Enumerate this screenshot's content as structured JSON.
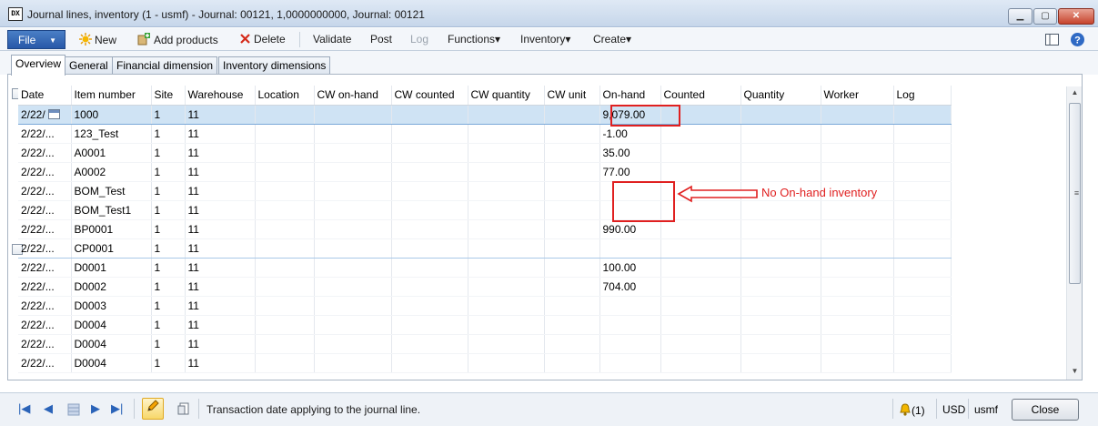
{
  "window": {
    "title": "Journal lines, inventory (1 - usmf) - Journal: 00121, 1,0000000000, Journal: 00121",
    "app_icon_text": "DX",
    "min_glyph": "▁",
    "max_glyph": "▢",
    "close_glyph": "✕"
  },
  "ribbon": {
    "file_label": "File",
    "new_label": "New",
    "add_products_label": "Add products",
    "delete_label": "Delete",
    "validate_label": "Validate",
    "post_label": "Post",
    "log_label": "Log",
    "functions_label": "Functions",
    "inventory_label": "Inventory",
    "create_label": "Create",
    "dropdown_glyph": "▾"
  },
  "tabs": [
    "Overview",
    "General",
    "Financial dimension",
    "Inventory dimensions"
  ],
  "grid": {
    "columns": [
      "Date",
      "Item number",
      "Site",
      "Warehouse",
      "Location",
      "CW on-hand",
      "CW counted",
      "CW quantity",
      "CW unit",
      "On-hand",
      "Counted",
      "Quantity",
      "Worker",
      "Log"
    ],
    "rows": [
      {
        "date": "2/22/",
        "item": "1000",
        "site": "1",
        "warehouse": "11",
        "onhand": "9,079.00"
      },
      {
        "date": "2/22/...",
        "item": "123_Test",
        "site": "1",
        "warehouse": "11",
        "onhand": "-1.00"
      },
      {
        "date": "2/22/...",
        "item": "A0001",
        "site": "1",
        "warehouse": "11",
        "onhand": "35.00"
      },
      {
        "date": "2/22/...",
        "item": "A0002",
        "site": "1",
        "warehouse": "11",
        "onhand": "77.00"
      },
      {
        "date": "2/22/...",
        "item": "BOM_Test",
        "site": "1",
        "warehouse": "11",
        "onhand": ""
      },
      {
        "date": "2/22/...",
        "item": "BOM_Test1",
        "site": "1",
        "warehouse": "11",
        "onhand": ""
      },
      {
        "date": "2/22/...",
        "item": "BP0001",
        "site": "1",
        "warehouse": "11",
        "onhand": "990.00"
      },
      {
        "date": "2/22/...",
        "item": "CP0001",
        "site": "1",
        "warehouse": "11",
        "onhand": ""
      },
      {
        "date": "2/22/...",
        "item": "D0001",
        "site": "1",
        "warehouse": "11",
        "onhand": "100.00"
      },
      {
        "date": "2/22/...",
        "item": "D0002",
        "site": "1",
        "warehouse": "11",
        "onhand": "704.00"
      },
      {
        "date": "2/22/...",
        "item": "D0003",
        "site": "1",
        "warehouse": "11",
        "onhand": ""
      },
      {
        "date": "2/22/...",
        "item": "D0004",
        "site": "1",
        "warehouse": "11",
        "onhand": ""
      },
      {
        "date": "2/22/...",
        "item": "D0004",
        "site": "1",
        "warehouse": "11",
        "onhand": ""
      },
      {
        "date": "2/22/...",
        "item": "D0004",
        "site": "1",
        "warehouse": "11",
        "onhand": ""
      }
    ],
    "scroll_up_glyph": "▲",
    "scroll_down_glyph": "▼",
    "grip_glyph": "≡"
  },
  "annotation": {
    "text": "No On-hand inventory",
    "color": "#e02020"
  },
  "status": {
    "message": "Transaction date applying to the journal line.",
    "nav_first": "|◀",
    "nav_prev": "◀",
    "nav_next": "▶",
    "nav_last": "▶|",
    "notifications": "(1)",
    "currency": "USD",
    "company": "usmf",
    "close_label": "Close"
  }
}
